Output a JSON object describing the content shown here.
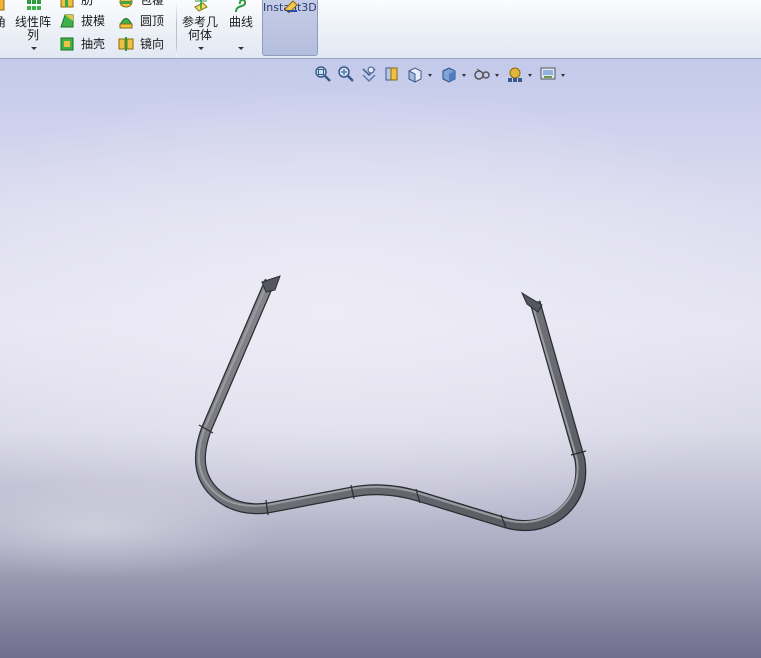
{
  "ribbon": {
    "left_partial_label": "角",
    "linear_pattern": {
      "line1": "线性阵",
      "line2": "列"
    },
    "rib": "肋",
    "wrap": "包覆",
    "draft": "拔模",
    "dome": "圆顶",
    "shell": "抽壳",
    "mirror": "镜向",
    "ref_geometry": {
      "line1": "参考几",
      "line2": "何体"
    },
    "curves": "曲线",
    "instant3d": "Instant3D"
  },
  "heads_up_toolbar": {
    "buttons": [
      "zoom-to-fit-icon",
      "zoom-to-area-icon",
      "previous-view-icon",
      "section-view-icon",
      "view-orientation-icon",
      "display-style-icon",
      "hide-show-items-icon",
      "edit-appearance-icon",
      "apply-scene-icon"
    ]
  },
  "colors": {
    "accent": "#2b3d72",
    "part_gray": "#6e7076",
    "instant3d_active": "#b9c2e0"
  }
}
